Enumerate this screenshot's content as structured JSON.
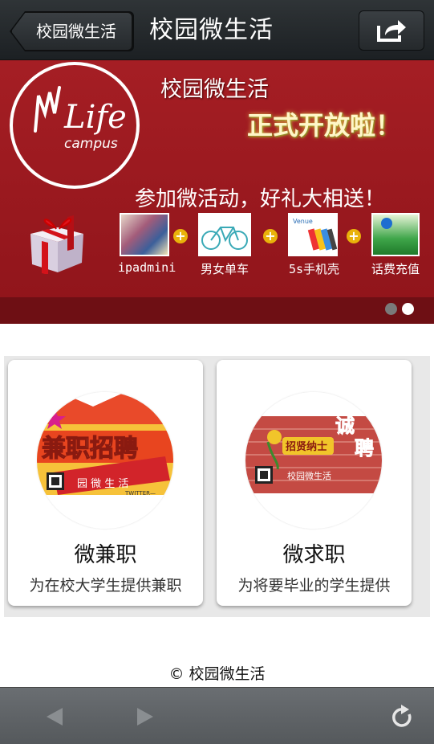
{
  "nav": {
    "back_label": "校园微生活",
    "title": "校园微生活",
    "share_icon": "share-icon"
  },
  "banner": {
    "title": "校园微生活",
    "headline": "正式开放啦！",
    "slogan": "参加微活动，好礼大相送！",
    "prizes": [
      {
        "label": "ipadmini",
        "icon": "ipad-icon"
      },
      {
        "label": "男女单车",
        "icon": "bicycle-icon"
      },
      {
        "label": "5s手机壳",
        "icon": "phone-case-icon"
      },
      {
        "label": "话费充值",
        "icon": "topup-card-icon"
      }
    ],
    "slide_count": 2,
    "active_slide": 2,
    "colors": {
      "primary": "#9d1a20",
      "accent": "#e9b20a"
    }
  },
  "cards": [
    {
      "title": "微兼职",
      "description": "为在校大学生提供兼职"
    },
    {
      "title": "微求职",
      "description": "为将要毕业的学生提供"
    }
  ],
  "footer": {
    "copyright": "© 校园微生活"
  },
  "toolbar": {
    "back_icon": "triangle-left-icon",
    "forward_icon": "triangle-right-icon",
    "refresh_icon": "refresh-icon"
  }
}
